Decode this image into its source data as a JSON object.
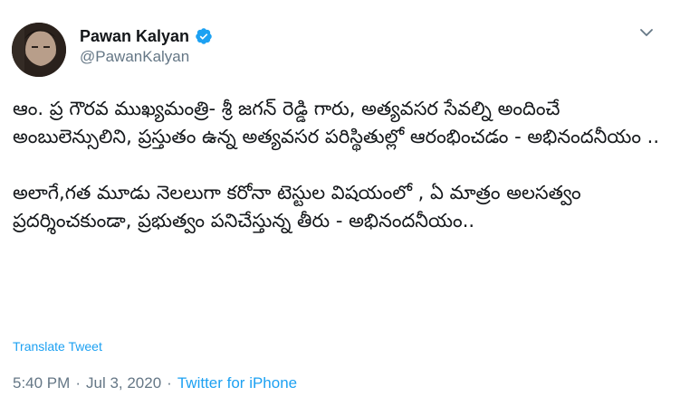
{
  "author": {
    "display_name": "Pawan Kalyan",
    "handle": "@PawanKalyan",
    "verified_icon": "verified-badge-icon"
  },
  "tweet": {
    "paragraphs": [
      "ఆం. ప్ర గౌరవ ముఖ్యమంత్రి- శ్రీ జగన్ రెడ్డి గారు, అత్యవసర సేవల్ని అందించే అంబులెన్సులిని, ప్రస్తుతం  ఉన్న అత్యవసర పరిస్థితుల్లో ఆరంభించడం - అభినందనీయం ..",
      "అలాగే,గత మూడు నెలలుగా కరోనా టెస్టుల విషయంలో , ఏ మాత్రం అలసత్వం ప్రదర్శించకుండా, ప్రభుత్వం పనిచేస్తున్న తీరు - అభినందనీయం.."
    ],
    "translate_label": "Translate Tweet"
  },
  "meta": {
    "time": "5:40 PM",
    "date": "Jul 3, 2020",
    "separator": "·",
    "source": "Twitter for iPhone"
  },
  "colors": {
    "link": "#1da1f2",
    "secondary_text": "#657786",
    "primary_text": "#14171a"
  }
}
